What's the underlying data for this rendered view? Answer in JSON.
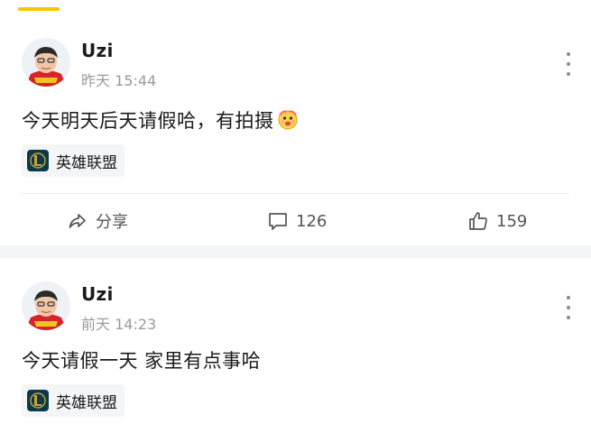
{
  "colors": {
    "accent": "#f7c600",
    "text_primary": "#1a1a1a",
    "text_secondary": "#9a9a9a",
    "tag_background": "#f4f5f7",
    "icon_gray": "#555555"
  },
  "posts": [
    {
      "author": "Uzi",
      "time": "昨天 15:44",
      "content": "今天明天后天请假哈，有拍摄",
      "emoji": "cheering-emoji-icon",
      "tag": {
        "label": "英雄联盟",
        "icon": "league-of-legends-icon"
      },
      "actions": {
        "share_label": "分享",
        "comment_count": "126",
        "like_count": "159"
      }
    },
    {
      "author": "Uzi",
      "time": "前天 14:23",
      "content": "今天请假一天 家里有点事哈",
      "tag": {
        "label": "英雄联盟",
        "icon": "league-of-legends-icon"
      }
    }
  ]
}
